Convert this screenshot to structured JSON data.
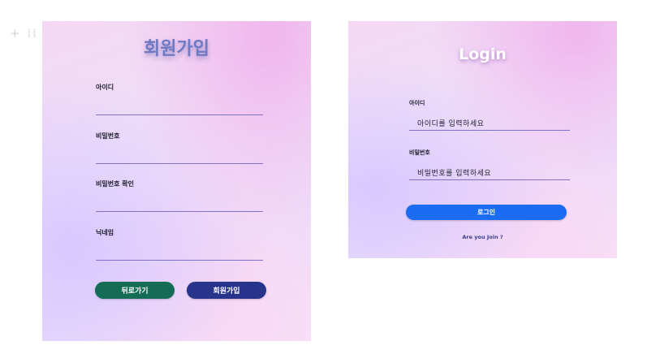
{
  "corner_handle": "+ ⁞⁞",
  "signup": {
    "title": "회원가입",
    "fields": [
      {
        "label": "아이디",
        "value": ""
      },
      {
        "label": "비밀번호",
        "value": ""
      },
      {
        "label": "비밀번호 확인",
        "value": ""
      },
      {
        "label": "닉네임",
        "value": ""
      }
    ],
    "back_button": "뒤로가기",
    "signup_button": "회원가입"
  },
  "login": {
    "title": "Login",
    "id_label": "아이디",
    "id_placeholder": "아이디를 입력하세요",
    "password_label": "비밀번호",
    "password_placeholder": "비밀번호를 입력하세요",
    "login_button": "로그인",
    "join_link": "Are you Join ?"
  },
  "colors": {
    "accent_line": "#7f72c8",
    "back_button": "#146c55",
    "signup_button": "#27348b",
    "login_button": "#1c6cf2",
    "signup_title": "#6f79c2"
  }
}
